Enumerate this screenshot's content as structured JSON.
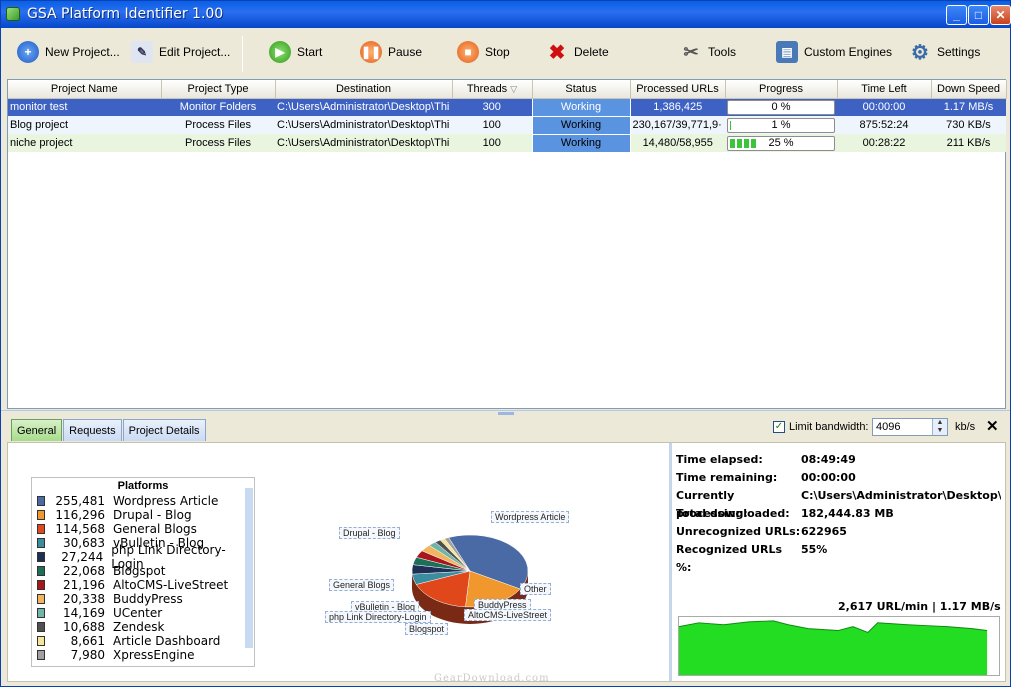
{
  "window": {
    "title": "GSA Platform Identifier 1.00",
    "min": "_",
    "max": "□",
    "close": "✕"
  },
  "toolbar": {
    "new_project": "New Project...",
    "edit_project": "Edit Project...",
    "start": "Start",
    "pause": "Pause",
    "stop": "Stop",
    "delete": "Delete",
    "tools": "Tools",
    "custom_engines": "Custom Engines",
    "settings": "Settings"
  },
  "grid": {
    "columns": [
      "Project Name",
      "Project Type",
      "Destination",
      "Threads",
      "Status",
      "Processed URLs",
      "Progress",
      "Time Left",
      "Down Speed"
    ],
    "rows": [
      {
        "name": "monitor test",
        "type": "Monitor Folders",
        "destination": "C:\\Users\\Administrator\\Desktop\\Thi",
        "threads": "300",
        "status": "Working",
        "processed": "1,386,425",
        "progress_text": "0 %",
        "progress": 0.0,
        "time_left": "00:00:00",
        "speed": "1.17 MB/s"
      },
      {
        "name": "Blog project",
        "type": "Process Files",
        "destination": "C:\\Users\\Administrator\\Desktop\\Thi",
        "threads": "100",
        "status": "Working",
        "processed": "230,167/39,771,9·",
        "progress_text": "1 %",
        "progress": 0.01,
        "time_left": "875:52:24",
        "speed": "730 KB/s"
      },
      {
        "name": "niche project",
        "type": "Process Files",
        "destination": "C:\\Users\\Administrator\\Desktop\\Thi",
        "threads": "100",
        "status": "Working",
        "processed": "14,480/58,955",
        "progress_text": "25 %",
        "progress": 0.25,
        "time_left": "00:28:22",
        "speed": "211 KB/s"
      }
    ]
  },
  "tabs": [
    "General",
    "Requests",
    "Project Details"
  ],
  "bandwidth": {
    "label": "Limit bandwidth:",
    "value": "4096",
    "unit": "kb/s",
    "checked": true
  },
  "legend": {
    "title": "Platforms",
    "items": [
      {
        "value": "255,481",
        "label": "Wordpress Article",
        "color": "#4a6aa5"
      },
      {
        "value": "116,296",
        "label": "Drupal - Blog",
        "color": "#f0982e"
      },
      {
        "value": "114,568",
        "label": "General Blogs",
        "color": "#e0481c"
      },
      {
        "value": "30,683",
        "label": "vBulletin - Blog",
        "color": "#3a8c9e"
      },
      {
        "value": "27,244",
        "label": "php Link Directory-Login",
        "color": "#1f2f55"
      },
      {
        "value": "22,068",
        "label": "Blogspot",
        "color": "#1e6f5a"
      },
      {
        "value": "21,196",
        "label": "AltoCMS-LiveStreet",
        "color": "#a8161c"
      },
      {
        "value": "20,338",
        "label": "BuddyPress",
        "color": "#f2b45e"
      },
      {
        "value": "14,169",
        "label": "UCenter",
        "color": "#6fb5a8"
      },
      {
        "value": "10,688",
        "label": "Zendesk",
        "color": "#505050"
      },
      {
        "value": "8,661",
        "label": "Article Dashboard",
        "color": "#f5e59a"
      },
      {
        "value": "7,980",
        "label": "XpressEngine",
        "color": "#a0a0a0"
      }
    ]
  },
  "pie_labels": {
    "wordpress": "Wordpress Article",
    "drupal": "Drupal - Blog",
    "general": "General Blogs",
    "vbulletin": "vBulletin - Blog",
    "phplink": "php Link Directory-Login",
    "blogspot": "Blogspot",
    "other": "Other",
    "buddypress": "BuddyPress",
    "alto": "AltoCMS-LiveStreet"
  },
  "stats": [
    {
      "k": "Time elapsed:",
      "v": "08:49:49"
    },
    {
      "k": "Time remaining:",
      "v": "00:00:00"
    },
    {
      "k": "Currently processing:",
      "v": "C:\\Users\\Administrator\\Desktop\\N"
    },
    {
      "k": "Total downloaded:",
      "v": "182,444.83 MB"
    },
    {
      "k": "Unrecognized URLs:",
      "v": "622965"
    },
    {
      "k": "Recognized URLs %:",
      "v": "55%"
    }
  ],
  "speed_label": "2,617 URL/min | 1.17 MB/s",
  "watermark": "GearDownload.com"
}
